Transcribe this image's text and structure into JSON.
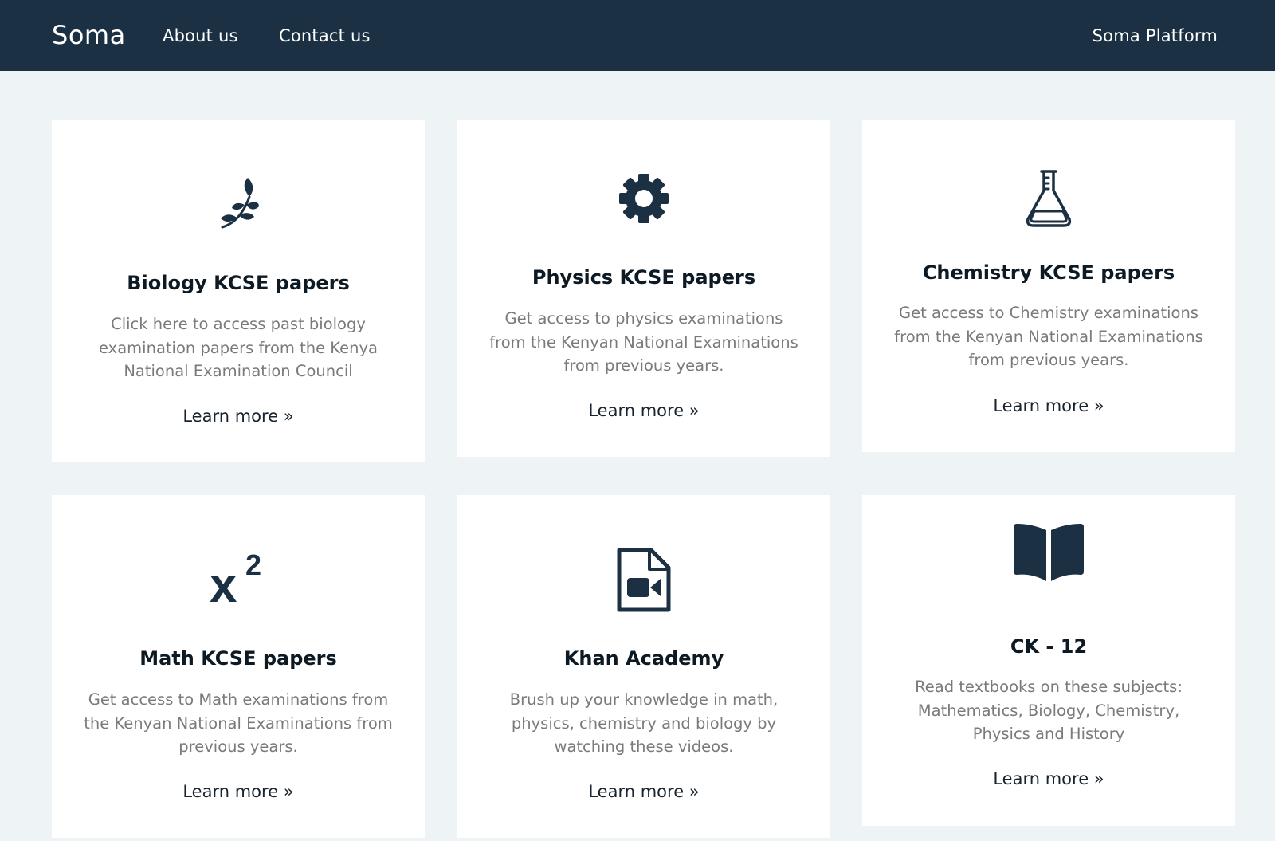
{
  "navbar": {
    "brand": "Soma",
    "links": [
      "About us",
      "Contact us"
    ],
    "right_link": "Soma Platform",
    "background": "#1b3042"
  },
  "cards": [
    {
      "icon": "leaf-icon",
      "title": "Biology KCSE papers",
      "description": "Click here to access past biology examination papers from the Kenya National Examination Council",
      "link": "Learn more »"
    },
    {
      "icon": "gear-icon",
      "title": "Physics KCSE papers",
      "description": "Get access to physics examinations from the Kenyan National Examinations from previous years.",
      "link": "Learn more »"
    },
    {
      "icon": "flask-icon",
      "title": "Chemistry KCSE papers",
      "description": "Get access to Chemistry examinations from the Kenyan National Examinations from previous years.",
      "link": "Learn more »"
    },
    {
      "icon": "superscript-icon",
      "title": "Math KCSE papers",
      "description": "Get access to Math examinations from the Kenyan National Examinations from previous years.",
      "link": "Learn more »"
    },
    {
      "icon": "video-file-icon",
      "title": "Khan Academy",
      "description": "Brush up your knowledge in math, physics, chemistry and biology by watching these videos.",
      "link": "Learn more »"
    },
    {
      "icon": "book-icon",
      "title": "CK - 12",
      "description": "Read textbooks on these subjects: Mathematics, Biology, Chemistry, Physics and History",
      "link": "Learn more »"
    }
  ],
  "colors": {
    "page_background": "#eef3f6",
    "icon": "#1b3042",
    "description_text": "#7a7a7a"
  }
}
